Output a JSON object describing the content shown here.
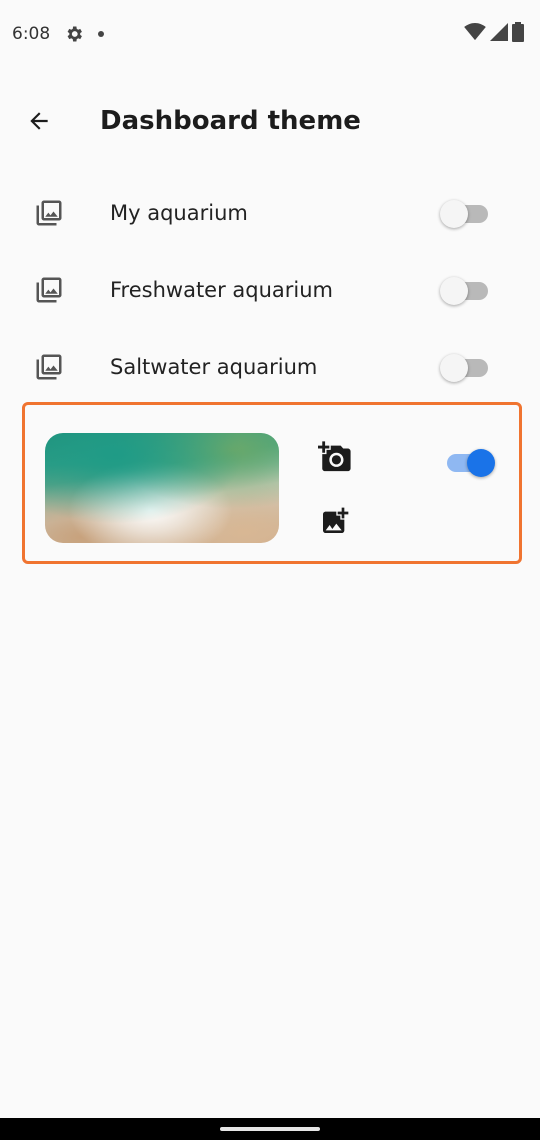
{
  "status_bar": {
    "time": "6:08",
    "icons": [
      "gear-icon",
      "notification-dot-icon",
      "wifi-icon",
      "signal-icon",
      "battery-icon"
    ]
  },
  "header": {
    "title": "Dashboard theme",
    "back_icon": "arrow-back-icon"
  },
  "themes": [
    {
      "label": "My aquarium",
      "icon": "image-library-icon",
      "enabled": false
    },
    {
      "label": "Freshwater aquarium",
      "icon": "image-library-icon",
      "enabled": false
    },
    {
      "label": "Saltwater aquarium",
      "icon": "image-library-icon",
      "enabled": false
    }
  ],
  "custom_theme": {
    "enabled": true,
    "camera_icon": "add-a-photo-icon",
    "gallery_icon": "add-photo-icon",
    "highlight_color": "#f07430"
  },
  "colors": {
    "background": "#fafafa",
    "accent": "#1a73e8",
    "accent_track": "#8fb8f2",
    "switch_off_track": "#b9b9b9"
  }
}
